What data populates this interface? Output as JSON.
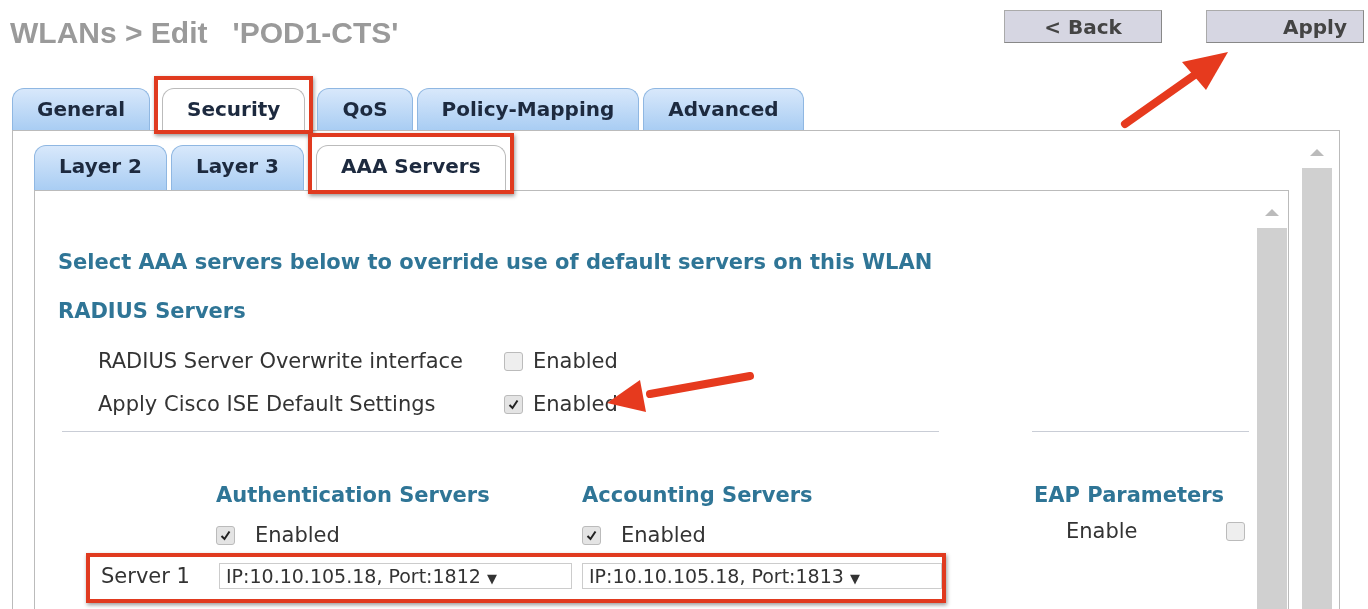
{
  "title": "WLANs > Edit   'POD1-CTS'",
  "buttons": [
    {
      "label": "< Back"
    },
    {
      "label": "Apply"
    }
  ],
  "tabs": [
    {
      "label": "General",
      "selected": false
    },
    {
      "label": "Security",
      "selected": true
    },
    {
      "label": "QoS",
      "selected": false
    },
    {
      "label": "Policy-Mapping",
      "selected": false
    },
    {
      "label": "Advanced",
      "selected": false
    }
  ],
  "subtabs": [
    {
      "label": "Layer 2",
      "selected": false
    },
    {
      "label": "Layer 3",
      "selected": false
    },
    {
      "label": "AAA Servers",
      "selected": true
    }
  ],
  "heading": "Select AAA servers below to override use of default servers on this WLAN",
  "section_title": "RADIUS Servers",
  "options": [
    {
      "label": "RADIUS Server Overwrite interface",
      "checked": false,
      "value_label": "Enabled"
    },
    {
      "label": "Apply Cisco ISE Default Settings",
      "checked": true,
      "value_label": "Enabled"
    }
  ],
  "server_columns": [
    {
      "heading": "Authentication Servers",
      "checked": true,
      "label": "Enabled"
    },
    {
      "heading": "Accounting Servers",
      "checked": true,
      "label": "Enabled"
    }
  ],
  "servers": [
    {
      "label": "Server 1",
      "selects": [
        "IP:10.10.105.18, Port:1812",
        "IP:10.10.105.18, Port:1813"
      ],
      "caret": "▼"
    }
  ],
  "eap": {
    "heading": "EAP Parameters",
    "label": "Enable",
    "checked": false
  }
}
